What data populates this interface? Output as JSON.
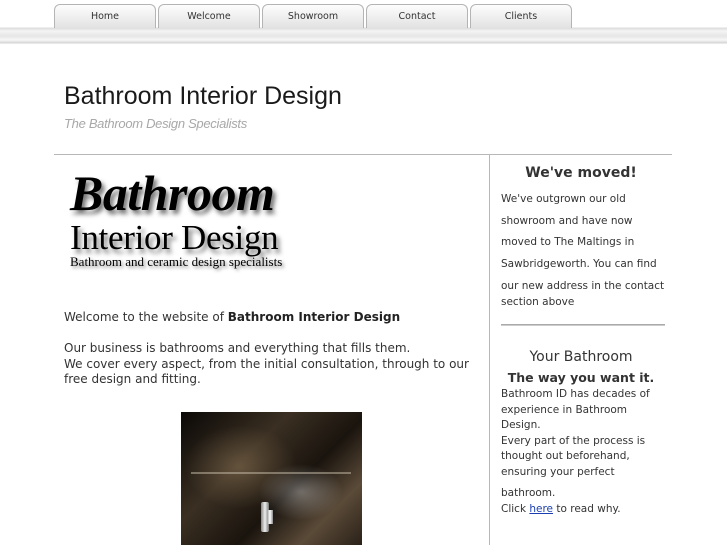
{
  "nav": {
    "tabs": [
      {
        "label": "Home"
      },
      {
        "label": "Welcome"
      },
      {
        "label": "Showroom"
      },
      {
        "label": "Contact"
      },
      {
        "label": "Clients"
      }
    ]
  },
  "header": {
    "title": "Bathroom Interior Design",
    "subtitle": "The Bathroom Design Specialists"
  },
  "logo": {
    "line1": "Bathroom",
    "line2": "Interior Design",
    "line3": "Bathroom and ceramic design specialists"
  },
  "main": {
    "welcome_prefix": "Welcome to the website of ",
    "welcome_name": "Bathroom Interior Design",
    "para_line1": "Our business is bathrooms and everything that fills them.",
    "para_line2": "We cover every aspect, from the initial consultation, through to our free design and fitting."
  },
  "sidebar": {
    "moved_heading": "We've moved!",
    "moved_text_a": "We've outgrown our old showroom and have now moved to The Maltings in Sawbridgeworth. You can find",
    "moved_text_b": "our new address in the contact section above",
    "your_heading": "Your Bathroom",
    "your_sub": "The way you want it.",
    "your_text_a": "Bathroom ID has decades of experience in Bathroom Design.",
    "your_text_b": "Every part of the process is thought out beforehand, ensuring your perfect",
    "your_text_c": "bathroom.",
    "click_prefix": "Click ",
    "click_link": "here",
    "click_suffix": " to read why."
  }
}
